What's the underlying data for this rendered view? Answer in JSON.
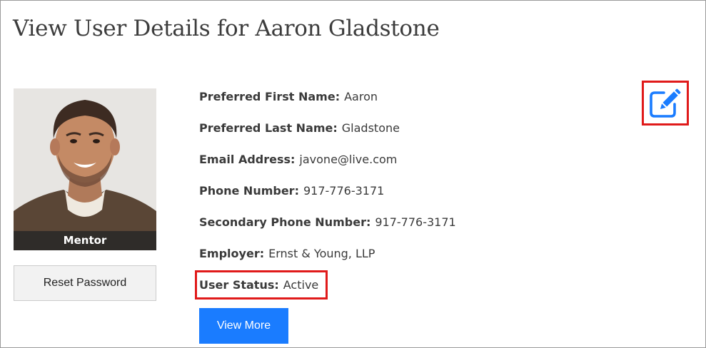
{
  "page": {
    "title": "View User Details for Aaron Gladstone"
  },
  "profile": {
    "role": "Mentor",
    "reset_password_label": "Reset Password"
  },
  "fields": [
    {
      "label": "Preferred First Name:",
      "value": "Aaron"
    },
    {
      "label": "Preferred Last Name:",
      "value": "Gladstone"
    },
    {
      "label": "Email Address:",
      "value": "javone@live.com"
    },
    {
      "label": "Phone Number:",
      "value": "917-776-3171"
    },
    {
      "label": "Secondary Phone Number:",
      "value": "917-776-3171"
    },
    {
      "label": "Employer:",
      "value": "Ernst & Young, LLP"
    },
    {
      "label": "User Status:",
      "value": "Active"
    }
  ],
  "actions": {
    "view_more_label": "View More",
    "edit_icon": "edit-icon"
  },
  "colors": {
    "accent": "#1a7cff",
    "highlight": "#e01a1a",
    "role_banner": "#2b2b2b"
  }
}
